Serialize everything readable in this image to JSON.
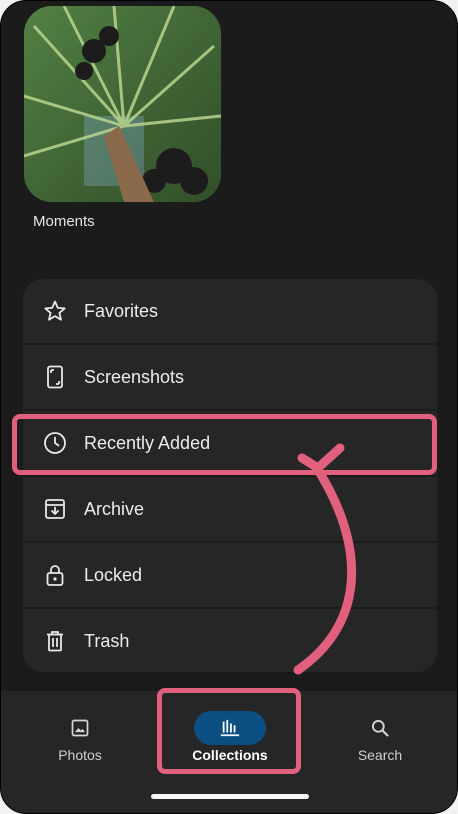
{
  "moments": {
    "label": "Moments"
  },
  "collections": [
    {
      "label": "Favorites",
      "icon": "star-icon"
    },
    {
      "label": "Screenshots",
      "icon": "phone-screenshot-icon"
    },
    {
      "label": "Recently Added",
      "icon": "clock-icon"
    },
    {
      "label": "Archive",
      "icon": "archive-icon"
    },
    {
      "label": "Locked",
      "icon": "lock-icon"
    },
    {
      "label": "Trash",
      "icon": "trash-icon"
    }
  ],
  "bottom_nav": [
    {
      "label": "Photos",
      "icon": "image-icon",
      "active": false
    },
    {
      "label": "Collections",
      "icon": "collections-icon",
      "active": true
    },
    {
      "label": "Search",
      "icon": "search-icon",
      "active": false
    }
  ],
  "colors": {
    "background": "#1b1b1c",
    "card": "#262627",
    "active_pill": "#0b4f82",
    "annotation": "#e0607e"
  }
}
